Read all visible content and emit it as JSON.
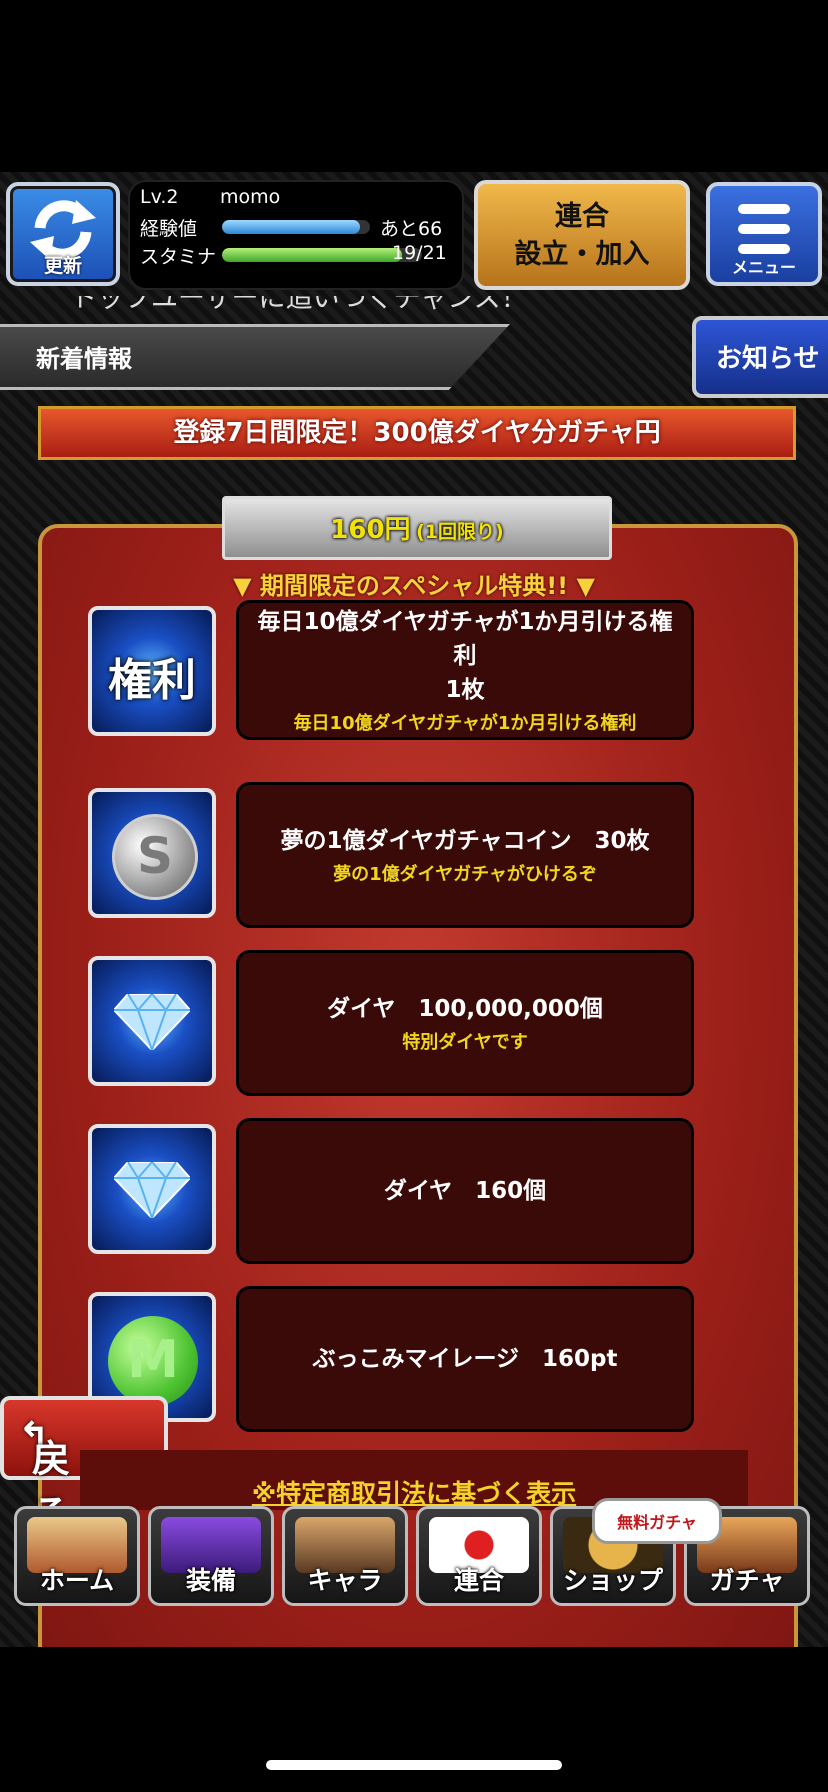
{
  "header": {
    "refresh_label": "更新",
    "level": "Lv.2",
    "username": "momo",
    "exp_label": "経験値",
    "exp_remaining": "あと66",
    "exp_progress": 0.93,
    "stamina_label": "スタミナ",
    "stamina_value": "19/21",
    "stamina_progress": 0.9,
    "union_line1": "連合",
    "union_line2": "設立・加入",
    "menu_label": "メニュー"
  },
  "ticker_text": "トップユーザーに追いつくチャンス！",
  "news": {
    "label": "新着情報",
    "notice_button": "お知らせ"
  },
  "campaign": {
    "title": "登録7日間限定！300億ダイヤ分ガチャ円"
  },
  "price": {
    "amount": "160円",
    "limit": "(1回限り)"
  },
  "special_heading": "▼ 期間限定のスペシャル特典!! ▼",
  "rewards": [
    {
      "icon": "kenri-ticket-icon",
      "icon_text": "権利",
      "title": "毎日10億ダイヤガチャが1か月引ける権利",
      "qty": "1枚",
      "sub": "毎日10億ダイヤガチャが1か月引ける権利"
    },
    {
      "icon": "silver-coin-icon",
      "icon_text": "S",
      "title": "夢の1億ダイヤガチャコイン　30枚",
      "sub": "夢の1億ダイヤガチャがひけるぞ"
    },
    {
      "icon": "diamond-icon",
      "title": "ダイヤ　100,000,000個",
      "sub": "特別ダイヤです"
    },
    {
      "icon": "diamond-icon",
      "title": "ダイヤ　160個",
      "sub": ""
    },
    {
      "icon": "mileage-coin-icon",
      "icon_text": "M",
      "title": "ぶっこみマイレージ　160pt",
      "sub": ""
    }
  ],
  "back_button": "戻る",
  "legal_link": "※特定商取引法に基づく表示",
  "nav": {
    "items": [
      "ホーム",
      "装備",
      "キャラ",
      "連合",
      "ショップ",
      "ガチャ"
    ],
    "free_gacha_badge": "無料ガチャ"
  },
  "colors": {
    "accent_gold": "#f2d51d",
    "card_red": "#9c1f19",
    "banner_orange": "#e8572d"
  }
}
